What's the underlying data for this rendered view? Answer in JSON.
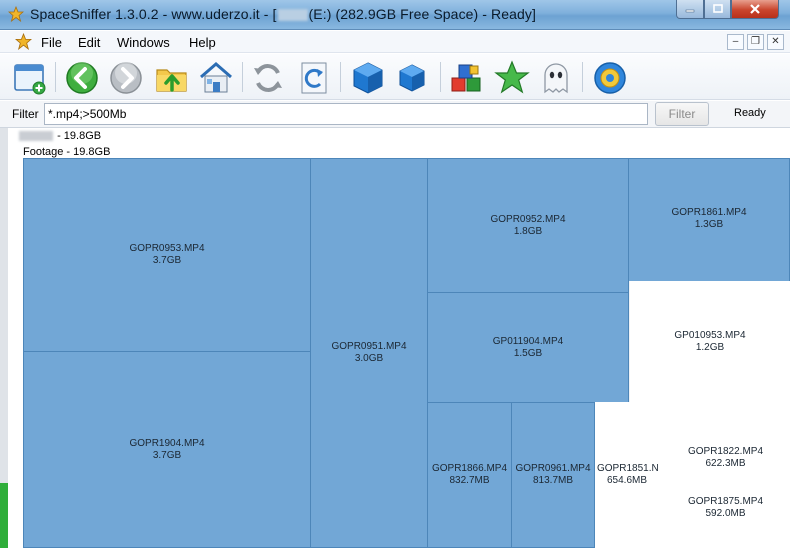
{
  "window": {
    "title_prefix": "SpaceSniffer 1.3.0.2 - www.uderzo.it - [",
    "title_suffix": "(E:) (282.9GB Free Space) - Ready]"
  },
  "menu": [
    "File",
    "Edit",
    "Windows",
    "Help"
  ],
  "toolbar": {
    "icons": [
      "new-scan-icon",
      "back-icon",
      "forward-icon",
      "go-up-folder-icon",
      "home-icon",
      "refresh-icon",
      "refresh-view-icon",
      "zoom-in-icon",
      "zoom-out-icon",
      "tags-icon",
      "favorites-star-icon",
      "ghost-icon",
      "settings-icon"
    ]
  },
  "filter": {
    "label": "Filter",
    "value": "*.mp4;>500Mb",
    "button": "Filter",
    "status": "Ready"
  },
  "treemap": {
    "root_size": "- 19.8GB",
    "folder_label": "Footage - 19.8GB",
    "colors": {
      "file": "#72a7d6",
      "border": "#4d86b9",
      "free": "#ffffff"
    },
    "files": [
      {
        "name": "GOPR0953.MP4",
        "size": "3.7GB"
      },
      {
        "name": "GOPR1904.MP4",
        "size": "3.7GB"
      },
      {
        "name": "GOPR0951.MP4",
        "size": "3.0GB"
      },
      {
        "name": "GOPR0952.MP4",
        "size": "1.8GB"
      },
      {
        "name": "GOPR1861.MP4",
        "size": "1.3GB"
      },
      {
        "name": "GP011904.MP4",
        "size": "1.5GB"
      },
      {
        "name": "GP010953.MP4",
        "size": "1.2GB"
      },
      {
        "name": "GOPR1866.MP4",
        "size": "832.7MB"
      },
      {
        "name": "GOPR0961.MP4",
        "size": "813.7MB"
      },
      {
        "name": "GOPR1851.N",
        "size": "654.6MB"
      },
      {
        "name": "GOPR1822.MP4",
        "size": "622.3MB"
      },
      {
        "name": "GOPR1875.MP4",
        "size": "592.0MB"
      }
    ]
  }
}
